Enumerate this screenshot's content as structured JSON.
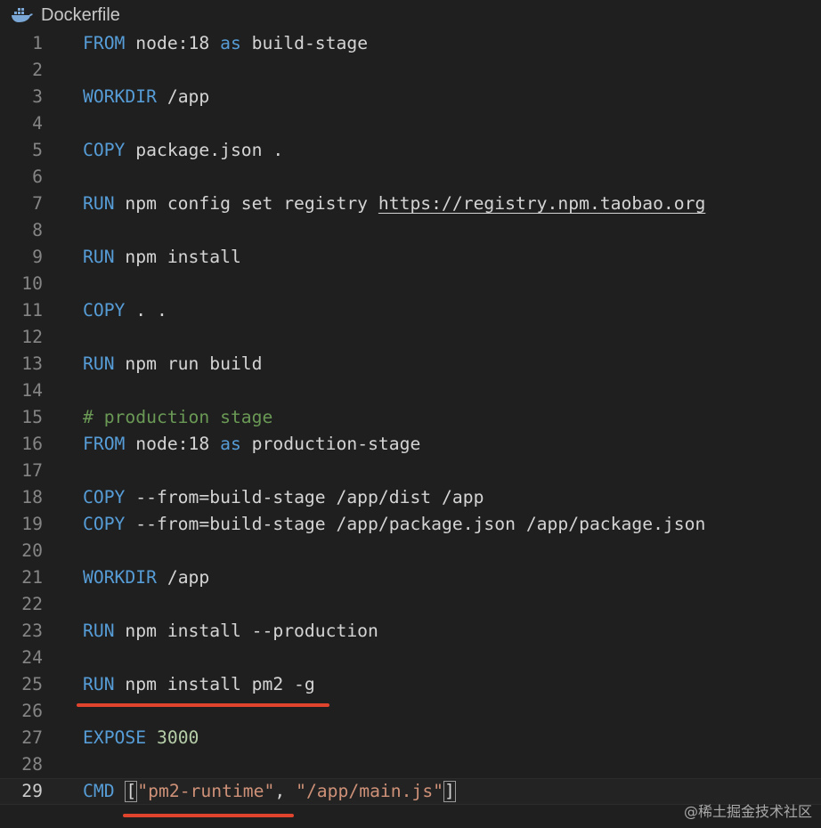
{
  "tab": {
    "file_name": "Dockerfile",
    "icon": "docker-whale-icon"
  },
  "colors": {
    "background": "#1f1f1f",
    "keyword": "#569cd6",
    "comment": "#6a9955",
    "string": "#ce9178",
    "number": "#b5cea8",
    "line_number": "#858585",
    "annotation": "#e0442c"
  },
  "editor": {
    "current_line": 29,
    "annotated_lines": [
      25,
      29
    ],
    "lines": [
      {
        "number": "1",
        "tokens": [
          {
            "type": "kw",
            "text": "FROM"
          },
          {
            "type": "plain",
            "text": " node:18 "
          },
          {
            "type": "kw",
            "text": "as"
          },
          {
            "type": "plain",
            "text": " build-stage"
          }
        ]
      },
      {
        "number": "2",
        "tokens": []
      },
      {
        "number": "3",
        "tokens": [
          {
            "type": "kw",
            "text": "WORKDIR"
          },
          {
            "type": "plain",
            "text": " /app"
          }
        ]
      },
      {
        "number": "4",
        "tokens": []
      },
      {
        "number": "5",
        "tokens": [
          {
            "type": "kw",
            "text": "COPY"
          },
          {
            "type": "plain",
            "text": " package.json ."
          }
        ]
      },
      {
        "number": "6",
        "tokens": []
      },
      {
        "number": "7",
        "tokens": [
          {
            "type": "kw",
            "text": "RUN"
          },
          {
            "type": "plain",
            "text": " npm config set registry "
          },
          {
            "type": "url",
            "text": "https://registry.npm.taobao.org"
          }
        ]
      },
      {
        "number": "8",
        "tokens": []
      },
      {
        "number": "9",
        "tokens": [
          {
            "type": "kw",
            "text": "RUN"
          },
          {
            "type": "plain",
            "text": " npm install"
          }
        ]
      },
      {
        "number": "10",
        "tokens": []
      },
      {
        "number": "11",
        "tokens": [
          {
            "type": "kw",
            "text": "COPY"
          },
          {
            "type": "plain",
            "text": " . ."
          }
        ]
      },
      {
        "number": "12",
        "tokens": []
      },
      {
        "number": "13",
        "tokens": [
          {
            "type": "kw",
            "text": "RUN"
          },
          {
            "type": "plain",
            "text": " npm run build"
          }
        ]
      },
      {
        "number": "14",
        "tokens": []
      },
      {
        "number": "15",
        "tokens": [
          {
            "type": "cm",
            "text": "# production stage"
          }
        ]
      },
      {
        "number": "16",
        "tokens": [
          {
            "type": "kw",
            "text": "FROM"
          },
          {
            "type": "plain",
            "text": " node:18 "
          },
          {
            "type": "kw",
            "text": "as"
          },
          {
            "type": "plain",
            "text": " production-stage"
          }
        ]
      },
      {
        "number": "17",
        "tokens": []
      },
      {
        "number": "18",
        "tokens": [
          {
            "type": "kw",
            "text": "COPY"
          },
          {
            "type": "plain",
            "text": " --from=build-stage /app/dist /app"
          }
        ]
      },
      {
        "number": "19",
        "tokens": [
          {
            "type": "kw",
            "text": "COPY"
          },
          {
            "type": "plain",
            "text": " --from=build-stage /app/package.json /app/package.json"
          }
        ]
      },
      {
        "number": "20",
        "tokens": []
      },
      {
        "number": "21",
        "tokens": [
          {
            "type": "kw",
            "text": "WORKDIR"
          },
          {
            "type": "plain",
            "text": " /app"
          }
        ]
      },
      {
        "number": "22",
        "tokens": []
      },
      {
        "number": "23",
        "tokens": [
          {
            "type": "kw",
            "text": "RUN"
          },
          {
            "type": "plain",
            "text": " npm install --production"
          }
        ]
      },
      {
        "number": "24",
        "tokens": []
      },
      {
        "number": "25",
        "tokens": [
          {
            "type": "kw",
            "text": "RUN"
          },
          {
            "type": "plain",
            "text": " npm install pm2 -g"
          }
        ]
      },
      {
        "number": "26",
        "tokens": []
      },
      {
        "number": "27",
        "tokens": [
          {
            "type": "kw",
            "text": "EXPOSE"
          },
          {
            "type": "plain",
            "text": " "
          },
          {
            "type": "num",
            "text": "3000"
          }
        ]
      },
      {
        "number": "28",
        "tokens": []
      },
      {
        "number": "29",
        "tokens": [
          {
            "type": "kw",
            "text": "CMD"
          },
          {
            "type": "plain",
            "text": " "
          },
          {
            "type": "bracket",
            "text": "["
          },
          {
            "type": "str",
            "text": "\"pm2-runtime\""
          },
          {
            "type": "plain",
            "text": ", "
          },
          {
            "type": "str",
            "text": "\"/app/main.js\""
          },
          {
            "type": "bracket",
            "text": "]"
          }
        ]
      }
    ]
  },
  "watermark": "@稀土掘金技术社区"
}
